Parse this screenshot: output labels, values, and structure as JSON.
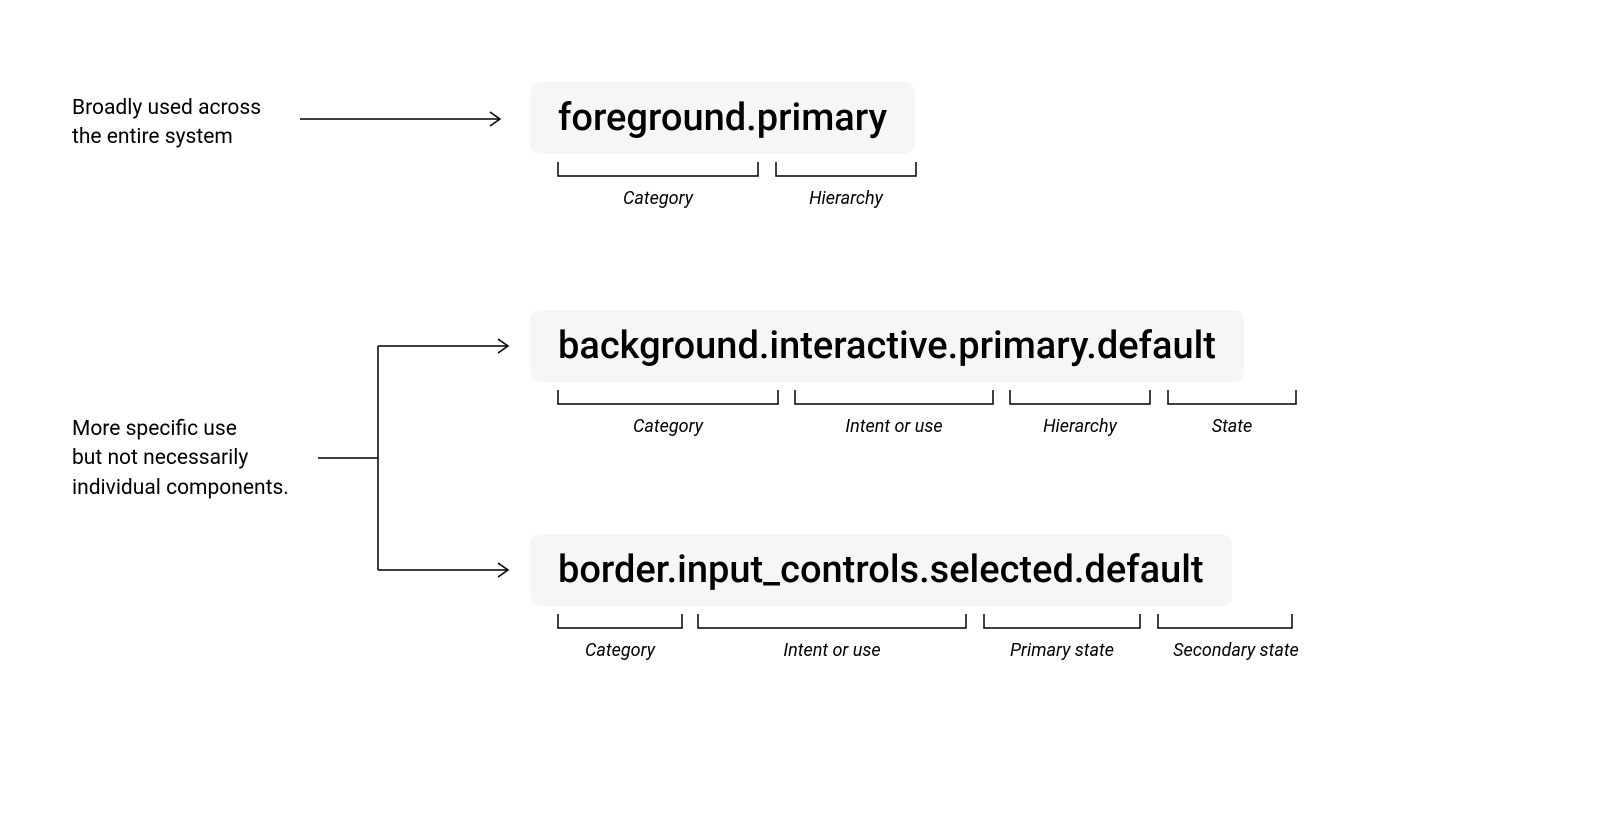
{
  "description1": "Broadly used across\nthe entire system",
  "description2": "More specific use\nbut not necessarily\nindividual components.",
  "token1": "foreground.primary",
  "token2": "background.interactive.primary.default",
  "token3": "border.input_controls.selected.default",
  "labels": {
    "category": "Category",
    "hierarchy": "Hierarchy",
    "intentOrUse": "Intent or use",
    "state": "State",
    "primaryState": "Primary state",
    "secondaryState": "Secondary state"
  }
}
